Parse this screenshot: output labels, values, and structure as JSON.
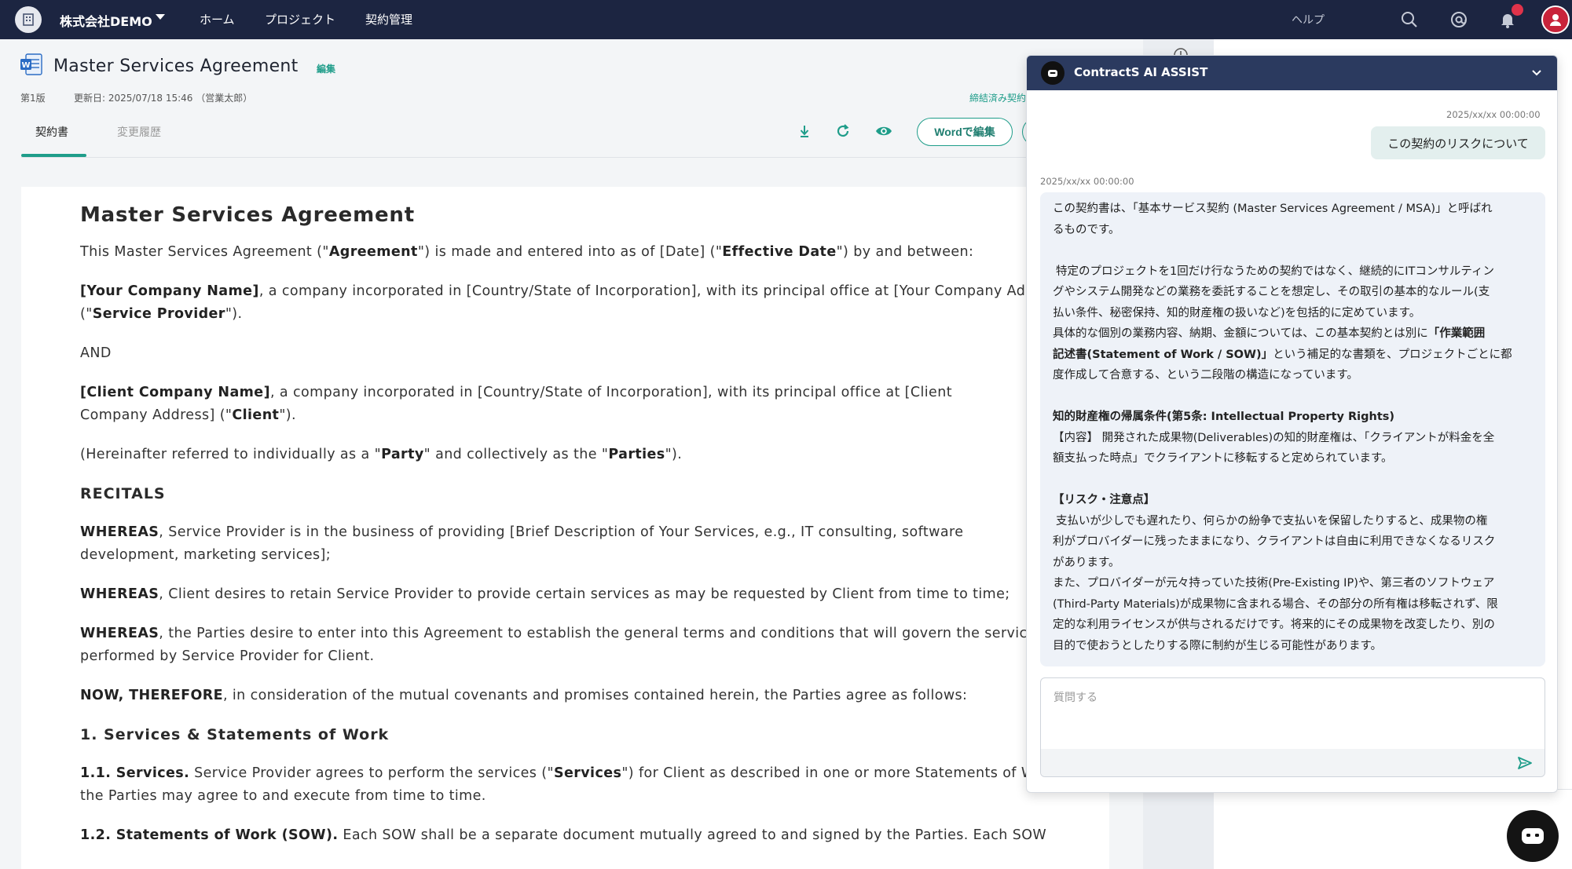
{
  "topbar": {
    "org_name": "株式会社DEMO",
    "nav": [
      "ホーム",
      "プロジェクト",
      "契約管理"
    ],
    "help": "ヘルプ",
    "icons": [
      "building-icon",
      "search-icon",
      "at-icon",
      "bell-icon",
      "user-avatar"
    ],
    "colors": {
      "bar": "#1c2541",
      "accent": "#1f9d8a",
      "notify": "#e0334a"
    }
  },
  "doc_header": {
    "title": "Master Services Agreement",
    "edit": "編集",
    "version": "第1版",
    "updated": "更新日: 2025/07/18 15:46 （営業太郎）",
    "signed_link": "締結済み契約",
    "tabs": [
      "契約書",
      "変更履歴"
    ],
    "word_edit_button": "Wordで編集"
  },
  "document": {
    "title": "Master Services Agreement",
    "intro": {
      "a": "This Master Services Agreement (\"",
      "b1": "Agreement",
      "c": "\") is made and entered into as of [Date] (\"",
      "b2": "Effective Date",
      "d": "\") by and between:"
    },
    "party1": {
      "b1": "[Your Company Name]",
      "a": ", a company incorporated in [Country/State of Incorporation], with its principal office at [Your Company Address] (\"",
      "b2": "Service Provider",
      "c": "\")."
    },
    "and": "AND",
    "party2": {
      "b1": "[Client Company Name]",
      "a": ", a company incorporated in [Country/State of Incorporation], with its principal office at [Client Company Address] (\"",
      "b2": "Client",
      "c": "\")."
    },
    "hereinafter": {
      "a": "(Hereinafter referred to individually as a \"",
      "b1": "Party",
      "c": "\" and collectively as the \"",
      "b2": "Parties",
      "d": "\")."
    },
    "recitals_heading": "RECITALS",
    "whereas1": {
      "b": "WHEREAS",
      "t": ", Service Provider is in the business of providing [Brief Description of Your Services, e.g., IT consulting, software development, marketing services];"
    },
    "whereas2": {
      "b": "WHEREAS",
      "t": ", Client desires to retain Service Provider to provide certain services as may be requested by Client from time to time;"
    },
    "whereas3": {
      "b": "WHEREAS",
      "t": ", the Parties desire to enter into this Agreement to establish the general terms and conditions that will govern the services to be performed by Service Provider for Client."
    },
    "now": {
      "b": "NOW, THEREFORE",
      "t": ", in consideration of the mutual covenants and promises contained herein, the Parties agree as follows:"
    },
    "section1_heading": "1. Services & Statements of Work",
    "clause11": {
      "b1": "1.1. Services.",
      "a": " Service Provider agrees to perform the services (\"",
      "b2": "Services",
      "c": "\") for Client as described in one or more Statements of Work that the Parties may agree to and execute from time to time."
    },
    "clause12_partial": {
      "b": "1.2. Statements of Work (SOW).",
      "t": " Each SOW shall be a separate document mutually agreed to and signed by the Parties. Each SOW"
    }
  },
  "ai": {
    "title": "ContractS AI ASSIST",
    "user_time": "2025/xx/xx 00:00:00",
    "user_message": "この契約のリスクについて",
    "ai_time": "2025/xx/xx 00:00:00",
    "response": {
      "l1": "この契約書は、「基本サービス契約 (Master Services Agreement / MSA)」と呼ばれ",
      "l2": "るものです。",
      "l3": "特定のプロジェクトを1回だけ行なうための契約ではなく、継続的にITコンサルティン",
      "l4": "グやシステム開発などの業務を委託することを想定し、その取引の基本的なルール(支",
      "l5": "払い条件、秘密保持、知的財産権の扱いなど)を包括的に定めています。",
      "l6a": "具体的な個別の業務内容、納期、金額については、この基本契約とは別に",
      "l6b": "「作業範囲",
      "l7b": "記述書(Statement of Work / SOW)」",
      "l7a": "という補足的な書類を、プロジェクトごとに都",
      "l8": "度作成して合意する、という二段階の構造になっています。",
      "l9": "知的財産権の帰属条件(第5条: Intellectual Property Rights)",
      "l10": "【内容】 開発された成果物(Deliverables)の知的財産権は、「クライアントが料金を全",
      "l11": "額支払った時点」でクライアントに移転すると定められています。",
      "l12": "【リスク・注意点】",
      "l13": "支払いが少しでも遅れたり、何らかの紛争で支払いを保留したりすると、成果物の権",
      "l14": "利がプロバイダーに残ったままになり、クライアントは自由に利用できなくなるリスク",
      "l15": "があります。",
      "l16": "また、プロバイダーが元々持っていた技術(Pre-Existing IP)や、第三者のソフトウェア",
      "l17": "(Third-Party Materials)が成果物に含まれる場合、その部分の所有権は移転されず、限",
      "l18": "定的な利用ライセンスが供与されるだけです。将来的にその成果物を改変したり、別の",
      "l19": "目的で使おうとしたりする際に制約が生じる可能性があります。"
    },
    "input_placeholder": "質問する"
  }
}
